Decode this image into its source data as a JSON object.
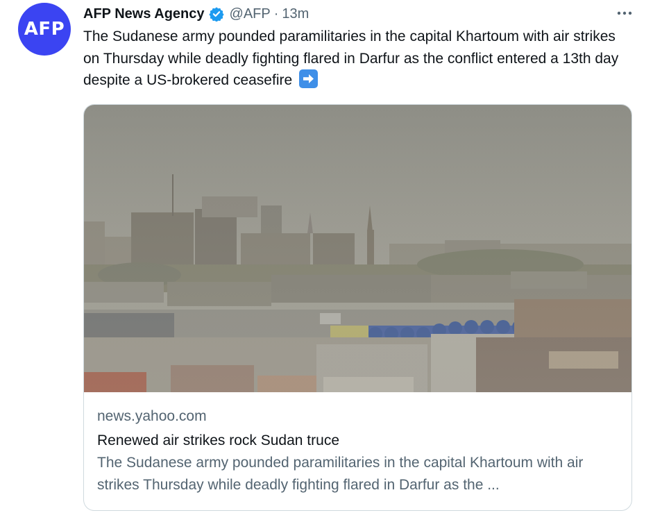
{
  "author": {
    "avatar_text": "AFP",
    "avatar_color": "#3b44f2",
    "name": "AFP News Agency",
    "verified": true,
    "handle": "@AFP",
    "separator": "·",
    "time": "13m"
  },
  "more_icon": "more-horizontal-icon",
  "tweet": {
    "text": "The Sudanese army pounded paramilitaries in the capital Khartoum with air strikes on Thursday while deadly fighting flared in Darfur as the conflict entered a 13th day despite a US-brokered ceasefire",
    "emoji": "right-arrow-emoji"
  },
  "link_card": {
    "domain": "news.yahoo.com",
    "title": "Renewed air strikes rock Sudan truce",
    "description": "The Sudanese army pounded paramilitaries in the capital Khartoum with air strikes Thursday while deadly fighting flared in Darfur as the ..."
  },
  "colors": {
    "text": "#0f1419",
    "secondary": "#536471",
    "border": "#cfd9de",
    "verified_blue": "#1d9bf0",
    "emoji_blue": "#3f8fe8"
  }
}
